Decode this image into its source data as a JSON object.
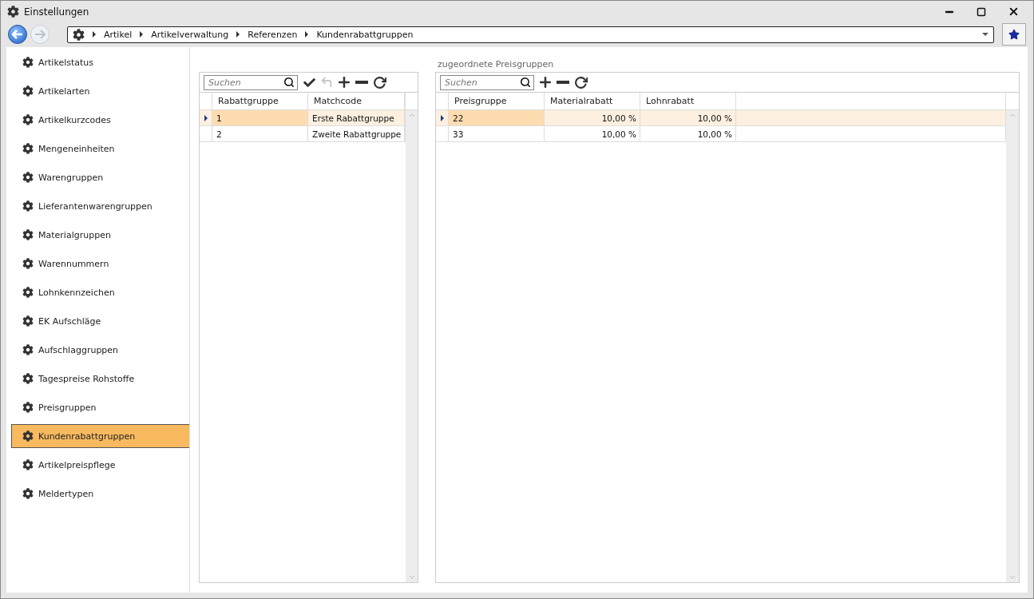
{
  "window": {
    "title": "Einstellungen"
  },
  "breadcrumb": [
    "Artikel",
    "Artikelverwaltung",
    "Referenzen",
    "Kundenrabattgruppen"
  ],
  "sidebar": {
    "items": [
      {
        "label": "Artikelstatus",
        "selected": false
      },
      {
        "label": "Artikelarten",
        "selected": false
      },
      {
        "label": "Artikelkurzcodes",
        "selected": false
      },
      {
        "label": "Mengeneinheiten",
        "selected": false
      },
      {
        "label": "Warengruppen",
        "selected": false
      },
      {
        "label": "Lieferantenwarengruppen",
        "selected": false
      },
      {
        "label": "Materialgruppen",
        "selected": false
      },
      {
        "label": "Warennummern",
        "selected": false
      },
      {
        "label": "Lohnkennzeichen",
        "selected": false
      },
      {
        "label": "EK Aufschläge",
        "selected": false
      },
      {
        "label": "Aufschlaggruppen",
        "selected": false
      },
      {
        "label": "Tagespreise Rohstoffe",
        "selected": false
      },
      {
        "label": "Preisgruppen",
        "selected": false
      },
      {
        "label": "Kundenrabattgruppen",
        "selected": true
      },
      {
        "label": "Artikelpreispflege",
        "selected": false
      },
      {
        "label": "Meldertypen",
        "selected": false
      }
    ]
  },
  "left_grid": {
    "search": {
      "placeholder": "Suchen"
    },
    "toolbar": [
      {
        "kind": "check",
        "disabled": false
      },
      {
        "kind": "undo",
        "disabled": true
      },
      {
        "kind": "add",
        "disabled": false
      },
      {
        "kind": "remove",
        "disabled": false
      },
      {
        "kind": "refresh",
        "disabled": false
      }
    ],
    "columns": [
      {
        "label": "Rabattgruppe"
      },
      {
        "label": "Matchcode"
      }
    ],
    "rows": [
      {
        "cells": [
          "1",
          "Erste Rabattgruppe"
        ],
        "selected": true
      },
      {
        "cells": [
          "2",
          "Zweite Rabattgruppe"
        ],
        "selected": false
      }
    ]
  },
  "right_grid": {
    "title": "zugeordnete Preisgruppen",
    "search": {
      "placeholder": "Suchen"
    },
    "toolbar": [
      {
        "kind": "add",
        "disabled": false
      },
      {
        "kind": "remove",
        "disabled": false
      },
      {
        "kind": "refresh",
        "disabled": false
      }
    ],
    "columns": [
      {
        "label": "Preisgruppe",
        "kind": "text"
      },
      {
        "label": "Materialrabatt",
        "kind": "number"
      },
      {
        "label": "Lohnrabatt",
        "kind": "number"
      }
    ],
    "rows": [
      {
        "cells": [
          "22",
          "10,00 %",
          "10,00 %"
        ],
        "selected": true
      },
      {
        "cells": [
          "33",
          "10,00 %",
          "10,00 %"
        ],
        "selected": false
      }
    ]
  }
}
